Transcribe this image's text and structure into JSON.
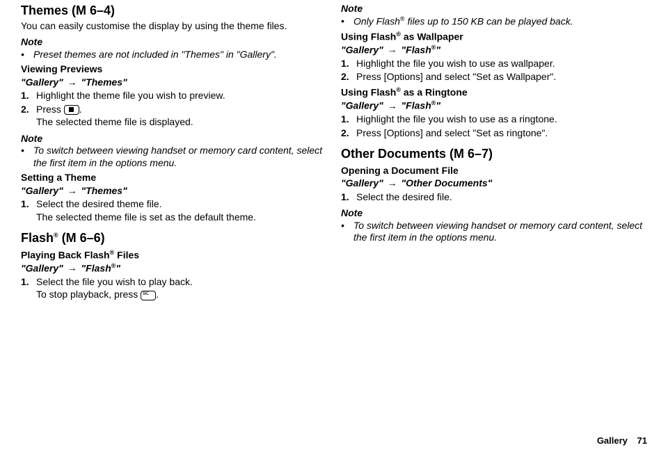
{
  "left": {
    "themes": {
      "title": "Themes (M 6–4)",
      "intro": "You can easily customise the display by using the theme files.",
      "note1_label": "Note",
      "note1_text": "Preset themes are not included in \"Themes\" in \"Gallery\".",
      "previews_title": "Viewing Previews",
      "previews_path_a": "\"Gallery\"",
      "previews_path_b": "\"Themes\"",
      "step1": "Highlight the theme file you wish to preview.",
      "step2a": "Press ",
      "step2b": ".",
      "step2c": "The selected theme file is displayed.",
      "note2_label": "Note",
      "note2_text": "To switch between viewing handset or memory card content, select the first item in the options menu.",
      "setting_title": "Setting a Theme",
      "setting_path_a": "\"Gallery\"",
      "setting_path_b": "\"Themes\"",
      "setting_step1a": "Select the desired theme file.",
      "setting_step1b": "The selected theme file is set as the default theme."
    },
    "flash": {
      "title_a": "Flash",
      "title_b": " (M 6–6)",
      "play_title_a": "Playing Back Flash",
      "play_title_b": " Files",
      "play_path_a": "\"Gallery\"",
      "play_path_b": "\"Flash",
      "play_path_c": "\"",
      "play_step1a": "Select the file you wish to play back.",
      "play_step1b_a": "To stop playback, press ",
      "play_step1b_b": "."
    }
  },
  "right": {
    "note_label": "Note",
    "note_text_a": "Only Flash",
    "note_text_b": " files up to 150 KB can be played back.",
    "wallpaper": {
      "title_a": "Using Flash",
      "title_b": " as Wallpaper",
      "path_a": "\"Gallery\"",
      "path_b": "\"Flash",
      "path_c": "\"",
      "step1": "Highlight the file you wish to use as wallpaper.",
      "step2": "Press [Options] and select \"Set as Wallpaper\"."
    },
    "ringtone": {
      "title_a": "Using Flash",
      "title_b": " as a Ringtone",
      "path_a": "\"Gallery\"",
      "path_b": "\"Flash",
      "path_c": "\"",
      "step1": "Highlight the file you wish to use as a ringtone.",
      "step2": "Press [Options] and select \"Set as ringtone\"."
    },
    "other": {
      "title": "Other Documents (M 6–7)",
      "opening_title": "Opening a Document File",
      "opening_path_a": "\"Gallery\"",
      "opening_path_b": "\"Other Documents\"",
      "step1": "Select the desired file.",
      "note_label": "Note",
      "note_text": "To switch between viewing handset or memory card content, select the first item in the options menu."
    }
  },
  "footer": {
    "label": "Gallery",
    "page": "71"
  },
  "sym": {
    "bullet": "•",
    "arrow": "→",
    "reg": "®"
  }
}
